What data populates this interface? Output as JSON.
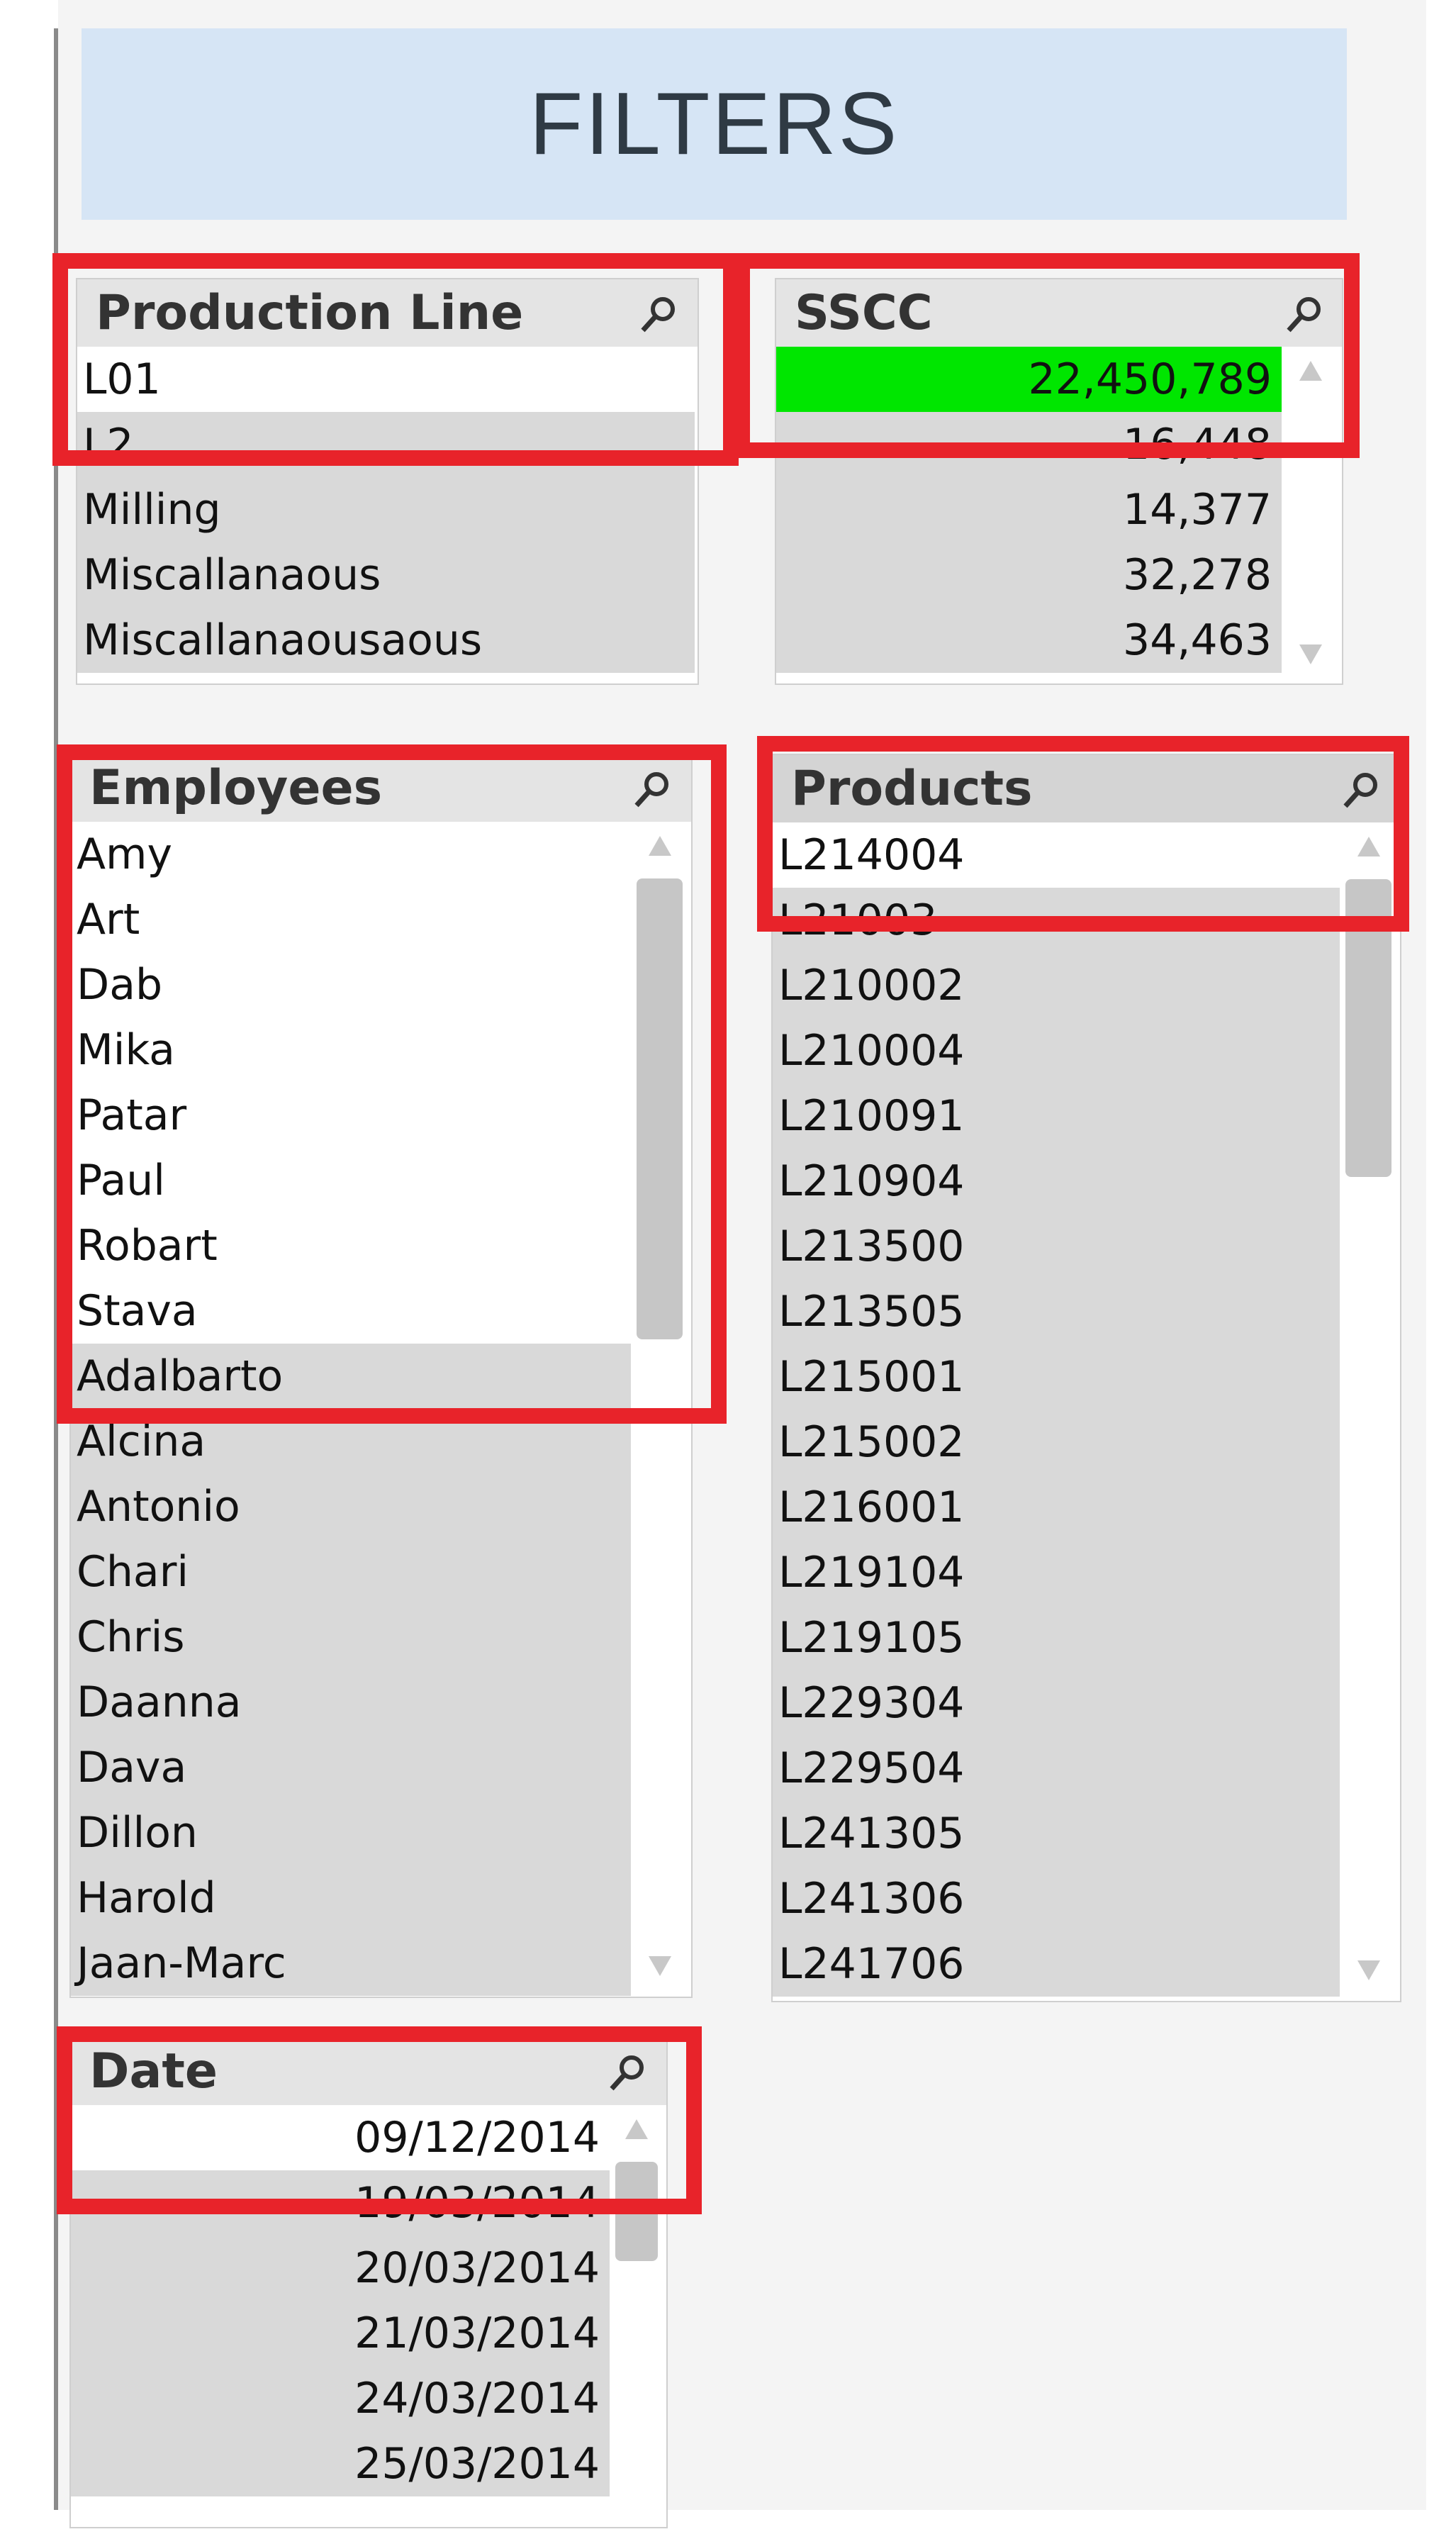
{
  "header": {
    "title": "FILTERS"
  },
  "production_line": {
    "title": "Production Line",
    "items": [
      "L01",
      "L2",
      "Milling",
      "Miscallanaous",
      "Miscallanaousaous"
    ]
  },
  "sscc": {
    "title": "SSCC",
    "items": [
      "22,450,789",
      "16,448",
      "14,377",
      "32,278",
      "34,463"
    ]
  },
  "employees": {
    "title": "Employees",
    "items": [
      "Amy",
      "Art",
      "Dab",
      "Mika",
      "Patar",
      "Paul",
      "Robart",
      "Stava",
      "Adalbarto",
      "Alcina",
      "Antonio",
      "Chari",
      "Chris",
      "Daanna",
      "Dava",
      "Dillon",
      "Harold",
      "Jaan-Marc"
    ]
  },
  "products": {
    "title": "Products",
    "items": [
      "L214004",
      "L21003",
      "L210002",
      "L210004",
      "L210091",
      "L210904",
      "L213500",
      "L213505",
      "L215001",
      "L215002",
      "L216001",
      "L219104",
      "L219105",
      "L229304",
      "L229504",
      "L241305",
      "L241306",
      "L241706"
    ]
  },
  "date": {
    "title": "Date",
    "items": [
      "09/12/2014",
      "19/03/2014",
      "20/03/2014",
      "21/03/2014",
      "24/03/2014",
      "25/03/2014"
    ]
  },
  "colors": {
    "selected": "#ffffff",
    "excluded": "#d9d9d9",
    "highlight": "#00e600",
    "annotation": "#e8232a",
    "banner": "#d6e5f5"
  },
  "icons": {
    "search": "search-icon",
    "scroll_up": "scroll-up-icon",
    "scroll_down": "scroll-down-icon"
  }
}
